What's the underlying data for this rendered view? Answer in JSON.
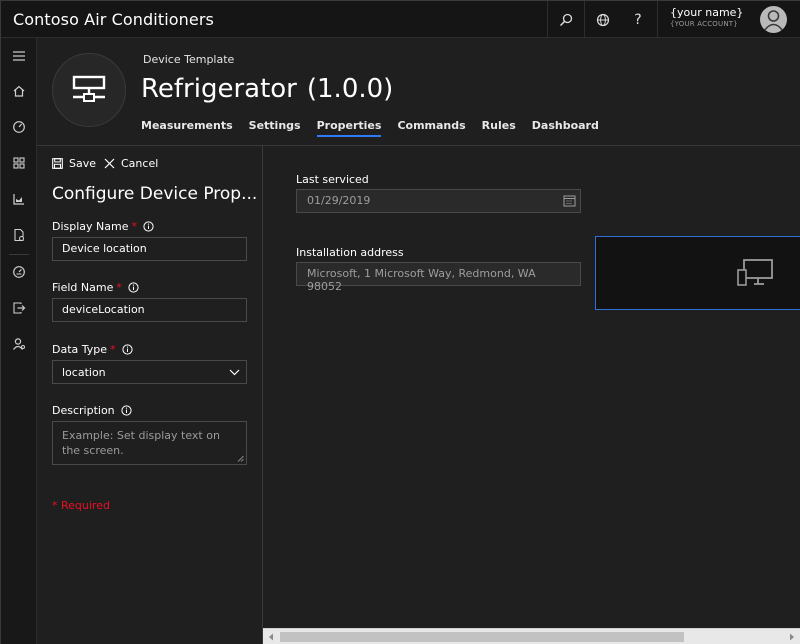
{
  "app": {
    "title": "Contoso Air Conditioners"
  },
  "topbar": {
    "search_icon": "search-icon",
    "globe_icon": "globe-icon",
    "help_label": "?",
    "user_name": "{your name}",
    "user_account": "{YOUR ACCOUNT}"
  },
  "rail": {
    "items": [
      "menu-icon",
      "home-icon",
      "dashboard-gauge-icon",
      "devices-grid-icon",
      "analytics-icon",
      "jobs-icon",
      "device-templates-icon",
      "export-icon",
      "admin-icon"
    ]
  },
  "header": {
    "breadcrumb": "Device Template",
    "name": "Refrigerator",
    "version": "(1.0.0)",
    "tabs": [
      {
        "label": "Measurements",
        "active": false
      },
      {
        "label": "Settings",
        "active": false
      },
      {
        "label": "Properties",
        "active": true
      },
      {
        "label": "Commands",
        "active": false
      },
      {
        "label": "Rules",
        "active": false
      },
      {
        "label": "Dashboard",
        "active": false
      }
    ]
  },
  "panel": {
    "save_label": "Save",
    "cancel_label": "Cancel",
    "title": "Configure Device Prop...",
    "display_name": {
      "label": "Display Name",
      "value": "Device location"
    },
    "field_name": {
      "label": "Field Name",
      "value": "deviceLocation"
    },
    "data_type": {
      "label": "Data Type",
      "value": "location"
    },
    "description": {
      "label": "Description",
      "placeholder": "Example: Set display text on the screen."
    },
    "required_star": "*",
    "required_note": "* Required"
  },
  "content": {
    "last_serviced": {
      "label": "Last serviced",
      "value": "01/29/2019"
    },
    "installation_address": {
      "label": "Installation address",
      "value": "Microsoft, 1 Microsoft Way, Redmond, WA 98052"
    }
  },
  "colors": {
    "accent": "#2f7bf5",
    "required": "#e81123",
    "background": "#1f1f1f",
    "topbar": "#151515"
  }
}
